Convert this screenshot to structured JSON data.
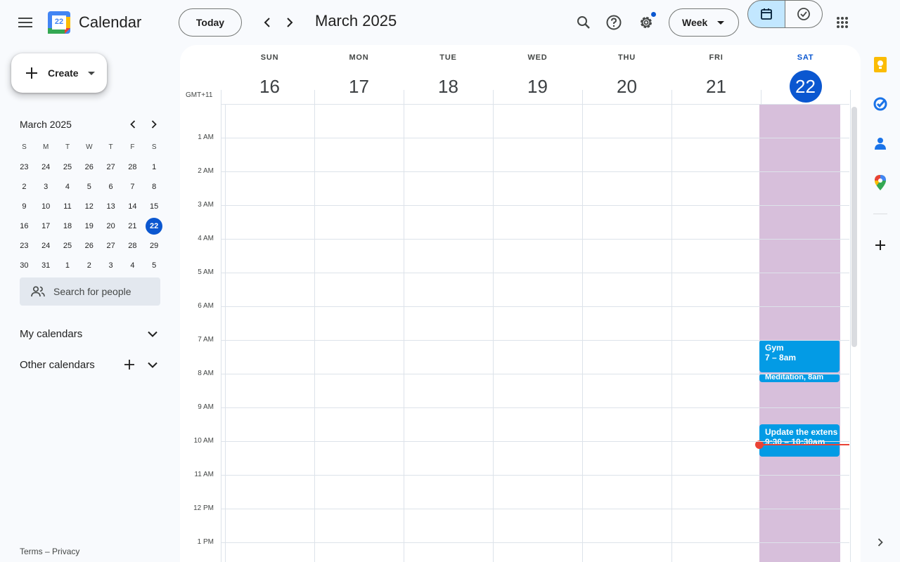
{
  "header": {
    "app_title": "Calendar",
    "logo_day": "22",
    "today_label": "Today",
    "period_title": "March 2025",
    "view_label": "Week"
  },
  "sidebar": {
    "create_label": "Create",
    "mini_calendar": {
      "title": "March 2025",
      "weekdays": [
        "S",
        "M",
        "T",
        "W",
        "T",
        "F",
        "S"
      ],
      "weeks": [
        [
          "23",
          "24",
          "25",
          "26",
          "27",
          "28",
          "1"
        ],
        [
          "2",
          "3",
          "4",
          "5",
          "6",
          "7",
          "8"
        ],
        [
          "9",
          "10",
          "11",
          "12",
          "13",
          "14",
          "15"
        ],
        [
          "16",
          "17",
          "18",
          "19",
          "20",
          "21",
          "22"
        ],
        [
          "23",
          "24",
          "25",
          "26",
          "27",
          "28",
          "29"
        ],
        [
          "30",
          "31",
          "1",
          "2",
          "3",
          "4",
          "5"
        ]
      ],
      "today": "22"
    },
    "search_people_placeholder": "Search for people",
    "my_calendars_label": "My calendars",
    "other_calendars_label": "Other calendars",
    "footer_terms": "Terms",
    "footer_separator": "–",
    "footer_privacy": "Privacy"
  },
  "week": {
    "timezone": "GMT+11",
    "days": [
      {
        "dow": "SUN",
        "num": "16"
      },
      {
        "dow": "MON",
        "num": "17"
      },
      {
        "dow": "TUE",
        "num": "18"
      },
      {
        "dow": "WED",
        "num": "19"
      },
      {
        "dow": "THU",
        "num": "20"
      },
      {
        "dow": "FRI",
        "num": "21"
      },
      {
        "dow": "SAT",
        "num": "22"
      }
    ],
    "hours": [
      "1 AM",
      "2 AM",
      "3 AM",
      "4 AM",
      "5 AM",
      "6 AM",
      "7 AM",
      "8 AM",
      "9 AM",
      "10 AM",
      "11 AM",
      "12 PM",
      "1 PM"
    ],
    "events": [
      {
        "title": "Gym",
        "time": "7 – 8am"
      },
      {
        "title": "Meditation, 8am"
      },
      {
        "title": "Update the extens",
        "time": "9:30 – 10:30am"
      }
    ]
  },
  "colors": {
    "accent": "#0b57d0",
    "event": "#039be5",
    "today_column": "#d7bfdb",
    "now_line": "#ea4335"
  }
}
